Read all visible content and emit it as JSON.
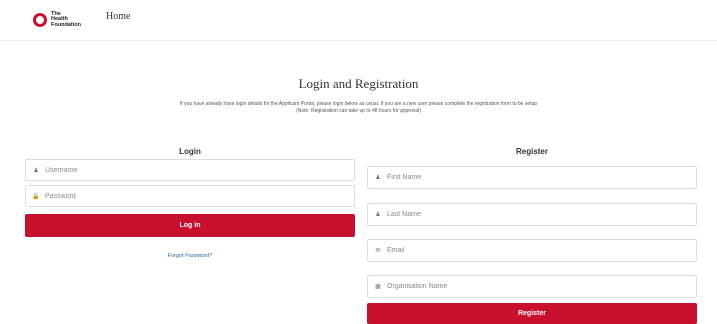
{
  "header": {
    "logo_text": "The\nHealth\nFoundation",
    "nav_home": "Home"
  },
  "main": {
    "title": "Login and Registration",
    "intro_line1": "If you have already have login details for the Applicant Portal, please login below as usual. If you are a new user please complete the registration form to be setup",
    "intro_line2": "(Note: Registration can take up to 48 hours for approval)"
  },
  "login": {
    "heading": "Login",
    "username_placeholder": "Username",
    "password_placeholder": "Password",
    "login_button": "Log in",
    "forgot_link": "Forgot Password?"
  },
  "register": {
    "heading": "Register",
    "first_name_placeholder": "First Name",
    "last_name_placeholder": "Last Name",
    "email_placeholder": "Email",
    "organisation_placeholder": "Organisation Name",
    "register_button": "Register"
  },
  "icons": {
    "user": "user-icon",
    "lock": "lock-icon",
    "envelope": "envelope-icon",
    "building": "building-icon"
  },
  "colors": {
    "brand": "#c8102e",
    "link": "#2a6aa8"
  }
}
